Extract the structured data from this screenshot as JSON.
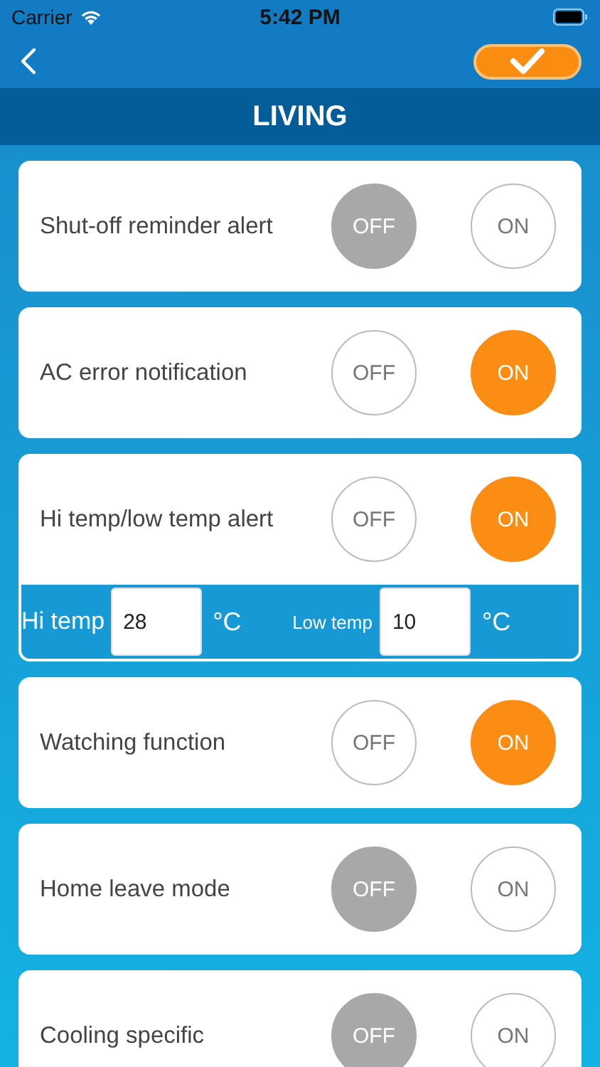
{
  "status_bar": {
    "carrier": "Carrier",
    "time": "5:42 PM"
  },
  "title": "LIVING",
  "settings": [
    {
      "label": "Shut-off reminder alert",
      "off_label": "OFF",
      "on_label": "ON",
      "on": false
    },
    {
      "label": "AC error notification",
      "off_label": "OFF",
      "on_label": "ON",
      "on": true
    },
    {
      "label": "Hi temp/low temp alert",
      "off_label": "OFF",
      "on_label": "ON",
      "on": true,
      "temps": {
        "hi_label": "Hi temp",
        "hi_value": "28",
        "hi_unit": "°C",
        "low_label": "Low temp",
        "low_value": "10",
        "low_unit": "°C"
      }
    },
    {
      "label": "Watching function",
      "off_label": "OFF",
      "on_label": "ON",
      "on": true
    },
    {
      "label": "Home leave mode",
      "off_label": "OFF",
      "on_label": "ON",
      "on": false
    },
    {
      "label": "Cooling specific",
      "off_label": "OFF",
      "on_label": "ON",
      "on": false
    }
  ]
}
